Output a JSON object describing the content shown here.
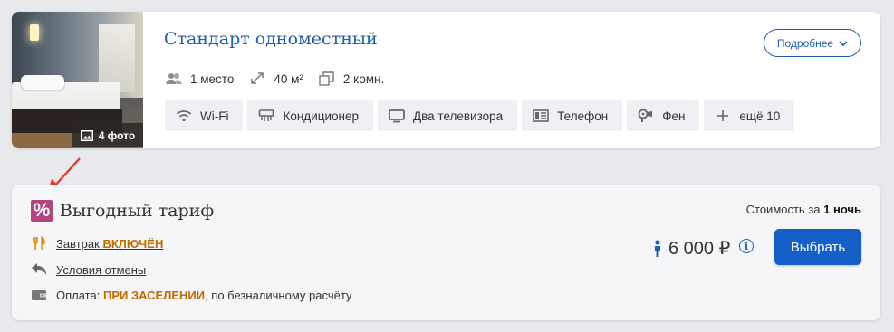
{
  "room": {
    "title": "Стандарт одноместный",
    "photo_count_label": "4 фото",
    "details_button": "Подробнее",
    "specs": [
      {
        "icon": "guests-icon",
        "label": "1 место"
      },
      {
        "icon": "area-icon",
        "label": "40 м²"
      },
      {
        "icon": "rooms-icon",
        "label": "2 комн."
      }
    ],
    "amenities": [
      {
        "icon": "wifi-icon",
        "label": "Wi-Fi"
      },
      {
        "icon": "air-conditioner-icon",
        "label": "Кондиционер"
      },
      {
        "icon": "tv-icon",
        "label": "Два телевизора"
      },
      {
        "icon": "phone-icon",
        "label": "Телефон"
      },
      {
        "icon": "hairdryer-icon",
        "label": "Фен"
      },
      {
        "icon": "plus-icon",
        "label": "ещё 10"
      }
    ]
  },
  "rate": {
    "percent_symbol": "%",
    "title": "Выгодный тариф",
    "breakfast_label": "Завтрак",
    "breakfast_status": "ВКЛЮЧЁН",
    "cancellation_label": "Условия отмены",
    "payment_prefix": "Оплата:",
    "payment_when": "ПРИ ЗАСЕЛЕНИИ",
    "payment_suffix": ", по безналичному расчёту",
    "cost_label": "Стоимость за",
    "cost_period": "1 ночь",
    "price": "6 000 ₽",
    "info_symbol": "i",
    "select_button": "Выбрать"
  },
  "colors": {
    "accent": "#1f5faa",
    "button": "#1560c8",
    "percent_badge": "#b2457d",
    "highlight": "#c36a00",
    "annotation_arrow": "#e53935"
  }
}
